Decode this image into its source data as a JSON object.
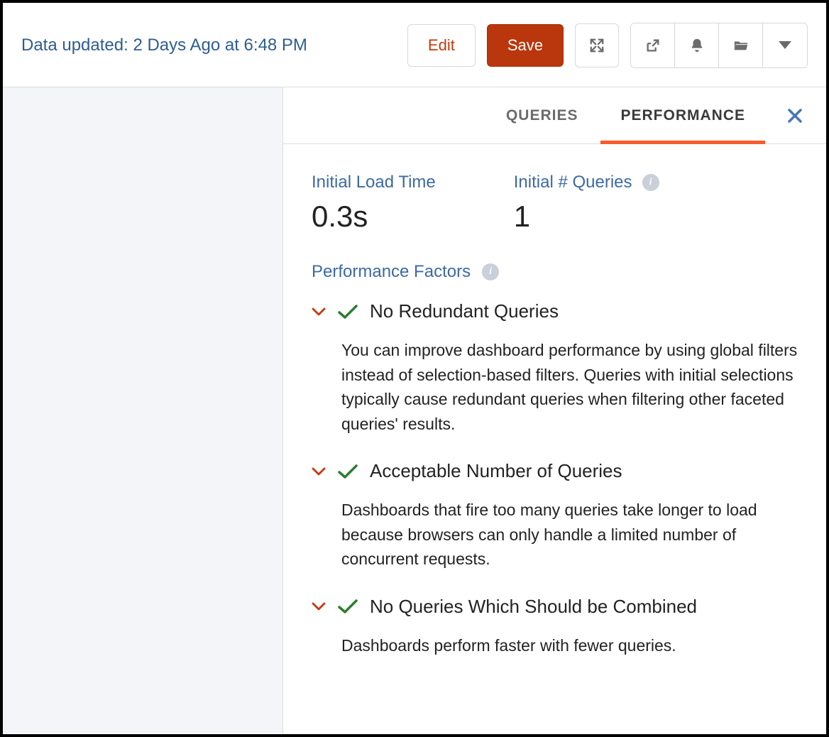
{
  "header": {
    "dataUpdated": "Data updated: 2 Days Ago at 6:48 PM",
    "editLabel": "Edit",
    "saveLabel": "Save"
  },
  "tabs": {
    "queries": "Queries",
    "performance": "Performance"
  },
  "metrics": {
    "loadTimeLabel": "Initial Load Time",
    "loadTimeValue": "0.3s",
    "queryCountLabel": "Initial # Queries",
    "queryCountValue": "1"
  },
  "factors": {
    "heading": "Performance Factors",
    "items": [
      {
        "title": "No Redundant Queries",
        "body": "You can improve dashboard performance by using global filters instead of selection-based filters. Queries with initial selections typically cause redundant queries when filtering other faceted queries' results."
      },
      {
        "title": "Acceptable Number of Queries",
        "body": "Dashboards that fire too many queries take longer to load because browsers can only handle a limited number of concurrent requests."
      },
      {
        "title": "No Queries Which Should be Combined",
        "body": "Dashboards perform faster with fewer queries."
      }
    ]
  }
}
